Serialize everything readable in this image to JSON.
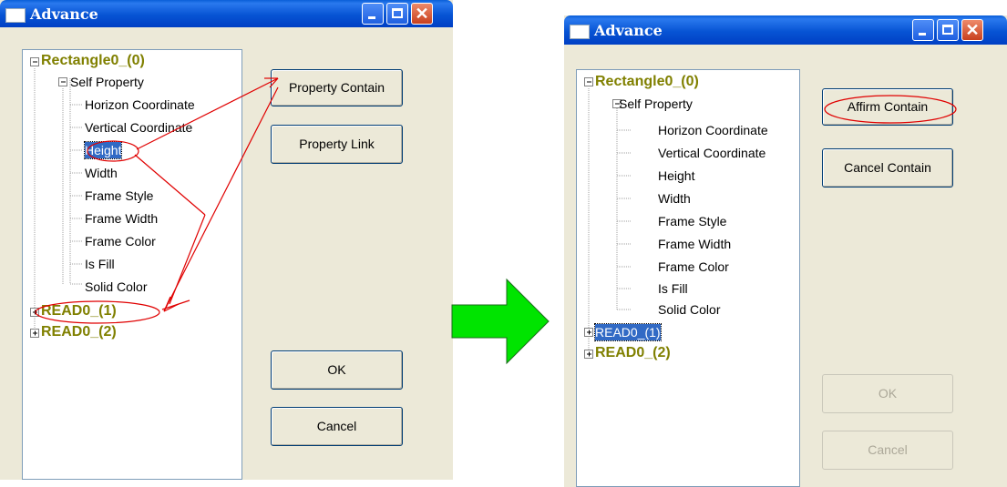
{
  "left": {
    "title": "Advance",
    "tree": {
      "root1": "Rectangle0_(0)",
      "self_property": "Self Property",
      "props": [
        "Horizon Coordinate",
        "Vertical Coordinate",
        "Height",
        "Width",
        "Frame Style",
        "Frame Width",
        "Frame Color",
        "Is Fill",
        "Solid Color"
      ],
      "read1": "READ0_(1)",
      "read2": "READ0_(2)"
    },
    "buttons": {
      "property_contain": "Property Contain",
      "property_link": "Property Link",
      "ok": "OK",
      "cancel": "Cancel"
    }
  },
  "right": {
    "title": "Advance",
    "tree": {
      "root1": "Rectangle0_(0)",
      "self_property": "Self Property",
      "props": [
        "Horizon Coordinate",
        "Vertical Coordinate",
        "Height",
        "Width",
        "Frame Style",
        "Frame Width",
        "Frame Color",
        "Is Fill",
        "Solid Color"
      ],
      "read1": "READ0_(1)",
      "read2": "READ0_(2)"
    },
    "buttons": {
      "affirm_contain": "Affirm Contain",
      "cancel_contain": "Cancel Contain",
      "ok": "OK",
      "cancel": "Cancel"
    }
  },
  "colors": {
    "arrow_fill": "#00e400",
    "annotation": "#e00000",
    "selection": "#316ac5",
    "root_text": "#808000"
  }
}
